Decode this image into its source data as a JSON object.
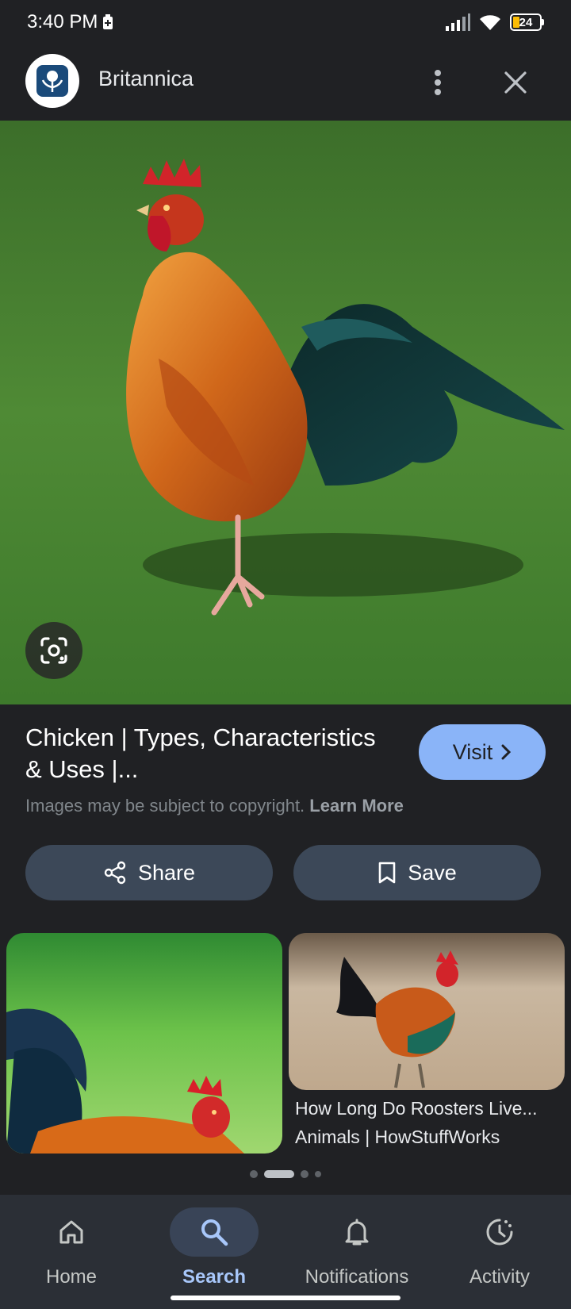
{
  "status_bar": {
    "time": "3:40 PM",
    "battery": "24"
  },
  "header": {
    "site_name": "Britannica"
  },
  "result": {
    "title": "Chicken | Types, Characteristics & Uses |...",
    "visit_label": "Visit",
    "copyright_text": "Images may be subject to copyright.",
    "learn_more": "Learn More"
  },
  "actions": {
    "share_label": "Share",
    "save_label": "Save"
  },
  "related": [
    {
      "caption_line1": "",
      "caption_line2": ""
    },
    {
      "caption_line1": "How Long Do Roosters Live...",
      "caption_line2": "Animals | HowStuffWorks"
    }
  ],
  "nav": {
    "items": [
      {
        "label": "Home",
        "icon": "home-icon"
      },
      {
        "label": "Search",
        "icon": "search-icon"
      },
      {
        "label": "Notifications",
        "icon": "bell-icon"
      },
      {
        "label": "Activity",
        "icon": "activity-icon"
      }
    ],
    "active": "Search"
  },
  "colors": {
    "background": "#202124",
    "accent": "#8ab4f8",
    "nav_background": "#2b2f36",
    "button_background": "#3c4858"
  }
}
